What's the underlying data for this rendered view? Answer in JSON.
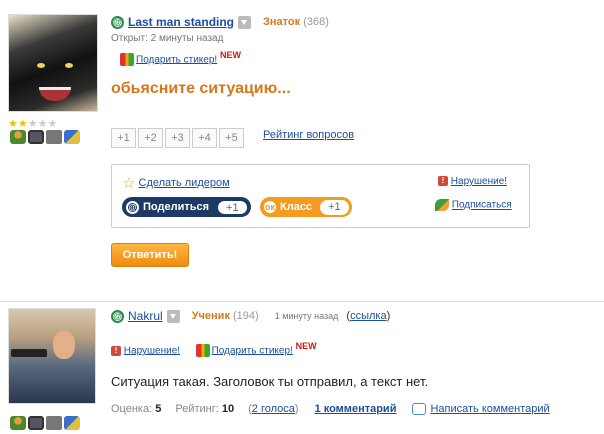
{
  "question": {
    "author": "Last man standing",
    "rank_name": "Знаток",
    "rank_points": "(368)",
    "opened": "Открыт: 2 минуты назад",
    "gift_label": "Подарить стикер!",
    "new_badge": "NEW",
    "title": "обьясните ситуацию...",
    "stars_on": 2,
    "stars_total": 5,
    "vote_buttons": [
      "+1",
      "+2",
      "+3",
      "+4",
      "+5"
    ],
    "rating_link": "Рейтинг вопросов",
    "panel": {
      "make_leader": "Сделать лидером",
      "share_label": "Поделиться",
      "share_count": "+1",
      "class_label": "Класс",
      "class_count": "+1",
      "report": "Нарушение!",
      "subscribe": "Подписаться"
    },
    "reply_button": "Ответить!"
  },
  "answer": {
    "author": "Nakrul",
    "rank_name": "Ученик",
    "rank_points": "(194)",
    "time": "1 минуту назад",
    "link_open": "(",
    "link": "ссылка",
    "link_close": ")",
    "report": "Нарушение!",
    "gift_label": "Подарить стикер!",
    "new_badge": "NEW",
    "text": "Ситуация такая. Заголовок ты отправил, а текст нет.",
    "score_label": "Оценка:",
    "score_value": "5",
    "rating_label": "Рейтинг:",
    "rating_value": "10",
    "votes_link": "2 голоса",
    "comments_link": "1 комментарий",
    "write_comment": "Написать комментарий"
  },
  "colors": {
    "accent_orange": "#d7771c",
    "link_blue": "#1a4fa0",
    "share_navy": "#1d3a66",
    "class_orange": "#f49b20"
  }
}
